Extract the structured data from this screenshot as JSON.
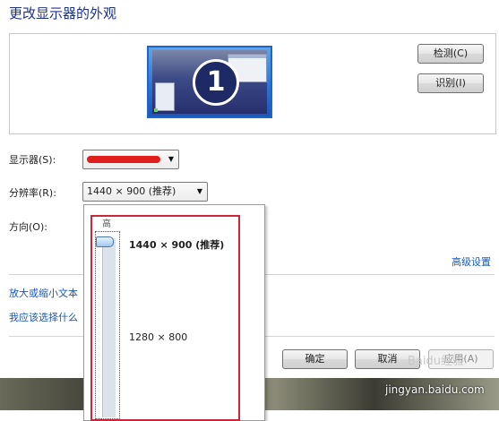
{
  "title": "更改显示器的外观",
  "preview": {
    "monitor_number": "1"
  },
  "buttons": {
    "detect": "检测(C)",
    "identify": "识别(I)",
    "ok": "确定",
    "cancel": "取消",
    "apply": "应用(A)"
  },
  "display": {
    "label": "显示器(S):",
    "value": ""
  },
  "resolution": {
    "label": "分辨率(R):",
    "value": "1440 × 900 (推荐)",
    "dropdown": {
      "slider_top_label": "高",
      "options": [
        "1440 × 900 (推荐)",
        "1280 × 800"
      ],
      "selected_index": 0
    }
  },
  "orientation": {
    "label": "方向(O):"
  },
  "links": {
    "advanced": "高级设置",
    "text_size": "放大或缩小文本",
    "which_settings": "我应该选择什么"
  },
  "watermark": {
    "brand": "Baidu经验",
    "url": "jingyan.baidu.com"
  },
  "colors": {
    "title": "#1e3287",
    "link": "#1a59b8",
    "highlight_border": "#c8283a",
    "redaction": "#e01e1e"
  },
  "icons": {
    "monitor": "monitor-icon",
    "dropdown_arrow": "chevron-down-icon",
    "slider_thumb": "slider-thumb-icon"
  }
}
